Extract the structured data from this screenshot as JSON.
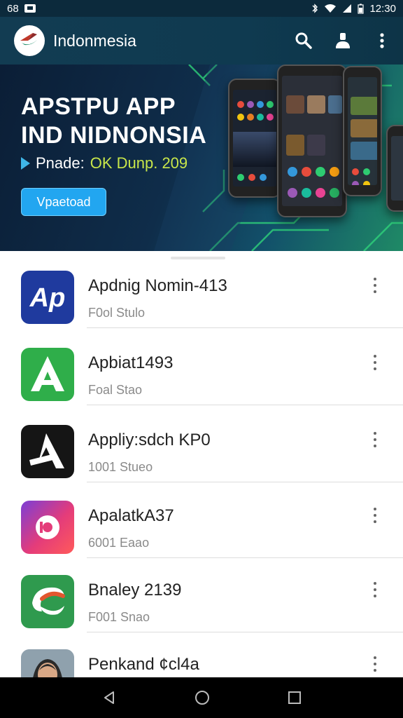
{
  "status_bar": {
    "left_text": "68",
    "time": "12:30"
  },
  "app_bar": {
    "title": "Indonmesia",
    "icons": [
      "search-icon",
      "account-icon",
      "more-vert-icon"
    ]
  },
  "banner": {
    "title_line1": "APSTPU APP",
    "title_line2": "IND NIDNONSIA",
    "subtitle_prefix": "Pnade:",
    "subtitle_highlight": "OK Dunp. 209",
    "button_label": "Vpaetoad"
  },
  "apps": [
    {
      "name": "Apdnig Nomin-413",
      "subtitle": "F0ol Stulo",
      "icon": "ap-logo-icon"
    },
    {
      "name": "Apbiat1493",
      "subtitle": "Foal Stao",
      "icon": "green-a-logo-icon"
    },
    {
      "name": "Appliy:sdch KP0",
      "subtitle": "1001 Stueo",
      "icon": "black-a-logo-icon"
    },
    {
      "name": "ApalatkA37",
      "subtitle": "6001 Eaao",
      "icon": "pink-gradient-logo-icon"
    },
    {
      "name": "Bnaley 2139",
      "subtitle": "F001 Snao",
      "icon": "green-swirl-logo-icon"
    },
    {
      "name": "Penkand ¢cl4a",
      "subtitle": "",
      "icon": "person-avatar-icon"
    }
  ],
  "nav_bar": {
    "icons": [
      "back-icon",
      "home-icon",
      "recents-icon"
    ]
  },
  "colors": {
    "app_bar": "#123c52",
    "accent_button": "#22a6f0",
    "highlight": "#c8e64a"
  }
}
